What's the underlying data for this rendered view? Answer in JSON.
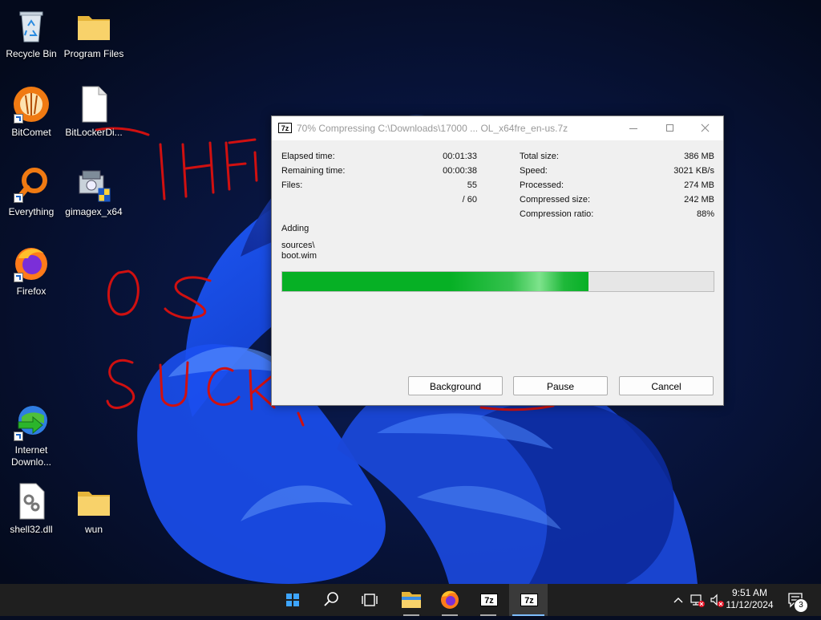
{
  "desktop": {
    "icons": [
      {
        "label": "Recycle Bin"
      },
      {
        "label": "Program Files"
      },
      {
        "label": "BitComet"
      },
      {
        "label": "BitLockerDi..."
      },
      {
        "label": "Everything"
      },
      {
        "label": "gimagex_x64"
      },
      {
        "label": "Firefox"
      },
      {
        "label": "Internet Downlo..."
      },
      {
        "label": "shell32.dll"
      },
      {
        "label": "wun"
      }
    ],
    "scribble_text": "I HATE OS SUCKS"
  },
  "dialog": {
    "app_icon": "7z",
    "title": "70% Compressing C:\\Downloads\\17000 ... OL_x64fre_en-us.7z",
    "left_stats": [
      {
        "label": "Elapsed time:",
        "value": "00:01:33"
      },
      {
        "label": "Remaining time:",
        "value": "00:00:38"
      },
      {
        "label": "Files:",
        "value": "55"
      },
      {
        "label": "",
        "value": "/ 60"
      }
    ],
    "right_stats": [
      {
        "label": "Total size:",
        "value": "386 MB"
      },
      {
        "label": "Speed:",
        "value": "3021 KB/s"
      },
      {
        "label": "Processed:",
        "value": "274 MB"
      },
      {
        "label": "Compressed size:",
        "value": "242 MB"
      },
      {
        "label": "Compression ratio:",
        "value": "88%"
      }
    ],
    "operation": "Adding",
    "current_path_line1": "sources\\",
    "current_path_line2": "boot.wim",
    "progress_fraction": 0.71,
    "buttons": {
      "background": "Background",
      "pause": "Pause",
      "cancel": "Cancel"
    }
  },
  "taskbar": {
    "pinned": [
      {
        "name": "start-icon"
      },
      {
        "name": "search-icon"
      },
      {
        "name": "task-view-icon"
      },
      {
        "name": "file-explorer-icon"
      },
      {
        "name": "firefox-icon"
      },
      {
        "name": "7zip-icon",
        "label": "7z"
      },
      {
        "name": "7zip-icon",
        "label": "7z",
        "active": true
      }
    ],
    "time": "9:51 AM",
    "date": "11/12/2024",
    "notification_count": "3"
  },
  "colors": {
    "progress_green": "#06b025",
    "taskbar": "#1f1f1f",
    "scribble_red": "#d01010"
  }
}
